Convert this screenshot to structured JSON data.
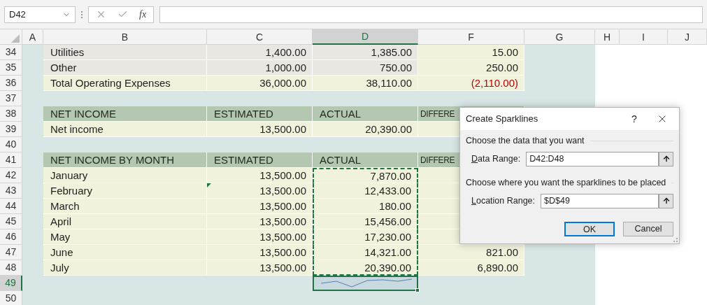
{
  "name_box": "D42",
  "formula_bar": {
    "function_label": "fx"
  },
  "columns": [
    {
      "label": "A",
      "selected": false
    },
    {
      "label": "B",
      "selected": false
    },
    {
      "label": "C",
      "selected": false
    },
    {
      "label": "D",
      "selected": true
    },
    {
      "label": "F",
      "selected": false
    },
    {
      "label": "G",
      "selected": false
    },
    {
      "label": "H",
      "selected": false
    },
    {
      "label": "I",
      "selected": false
    },
    {
      "label": "J",
      "selected": false
    }
  ],
  "rows": [
    {
      "number": "34",
      "kind": "gray",
      "selected": false,
      "marquee": false,
      "label": "Utilities",
      "estimated": "1,400.00",
      "actual": "1,385.00",
      "difference": "15.00",
      "negative": false
    },
    {
      "number": "35",
      "kind": "gray",
      "selected": false,
      "marquee": false,
      "label": "Other",
      "estimated": "1,000.00",
      "actual": "750.00",
      "difference": "250.00",
      "negative": false
    },
    {
      "number": "36",
      "kind": "cream",
      "selected": false,
      "marquee": false,
      "label": "Total Operating Expenses",
      "estimated": "36,000.00",
      "actual": "38,110.00",
      "difference": "(2,110.00)",
      "negative": true
    },
    {
      "number": "37",
      "kind": "blank",
      "selected": false
    },
    {
      "number": "38",
      "kind": "header",
      "selected": false,
      "label": "NET INCOME",
      "estimated": "ESTIMATED",
      "actual": "ACTUAL",
      "difference": "DIFFERE"
    },
    {
      "number": "39",
      "kind": "cream",
      "selected": false,
      "marquee": false,
      "label": "Net income",
      "estimated": "13,500.00",
      "actual": "20,390.00"
    },
    {
      "number": "40",
      "kind": "blank",
      "selected": false
    },
    {
      "number": "41",
      "kind": "header",
      "selected": false,
      "label": "NET INCOME BY MONTH",
      "estimated": "ESTIMATED",
      "actual": "ACTUAL",
      "difference": "DIFFERE"
    },
    {
      "number": "42",
      "kind": "cream",
      "selected": false,
      "marquee": true,
      "label": "January",
      "estimated": "13,500.00",
      "actual": "7,870.00"
    },
    {
      "number": "43",
      "kind": "cream",
      "selected": false,
      "marquee": true,
      "label": "February",
      "estimated": "13,500.00",
      "actual": "12,433.00",
      "error_indicator": true
    },
    {
      "number": "44",
      "kind": "cream",
      "selected": false,
      "marquee": true,
      "label": "March",
      "estimated": "13,500.00",
      "actual": "180.00"
    },
    {
      "number": "45",
      "kind": "cream",
      "selected": false,
      "marquee": true,
      "label": "April",
      "estimated": "13,500.00",
      "actual": "15,456.00"
    },
    {
      "number": "46",
      "kind": "cream",
      "selected": false,
      "marquee": true,
      "label": "May",
      "estimated": "13,500.00",
      "actual": "17,230.00"
    },
    {
      "number": "47",
      "kind": "cream",
      "selected": false,
      "marquee": true,
      "label": "June",
      "estimated": "13,500.00",
      "actual": "14,321.00",
      "difference": "821.00",
      "negative": false
    },
    {
      "number": "48",
      "kind": "cream",
      "selected": false,
      "marquee": true,
      "label": "July",
      "estimated": "13,500.00",
      "actual": "20,390.00",
      "difference": "6,890.00",
      "negative": false
    },
    {
      "number": "49",
      "kind": "sparkline",
      "selected": true
    },
    {
      "number": "50",
      "kind": "blank",
      "selected": false
    }
  ],
  "dialog": {
    "title": "Create Sparklines",
    "help": "?",
    "sections": [
      {
        "heading": "Choose the data that you want",
        "access_key": "D",
        "label": "ata Range:",
        "value": "D42:D48"
      },
      {
        "heading": "Choose where you want the sparklines to be placed",
        "access_key": "L",
        "label": "ocation Range:",
        "value": "$D$49"
      }
    ],
    "buttons": [
      {
        "label": "OK",
        "default": true
      },
      {
        "label": "Cancel",
        "default": false
      }
    ]
  }
}
